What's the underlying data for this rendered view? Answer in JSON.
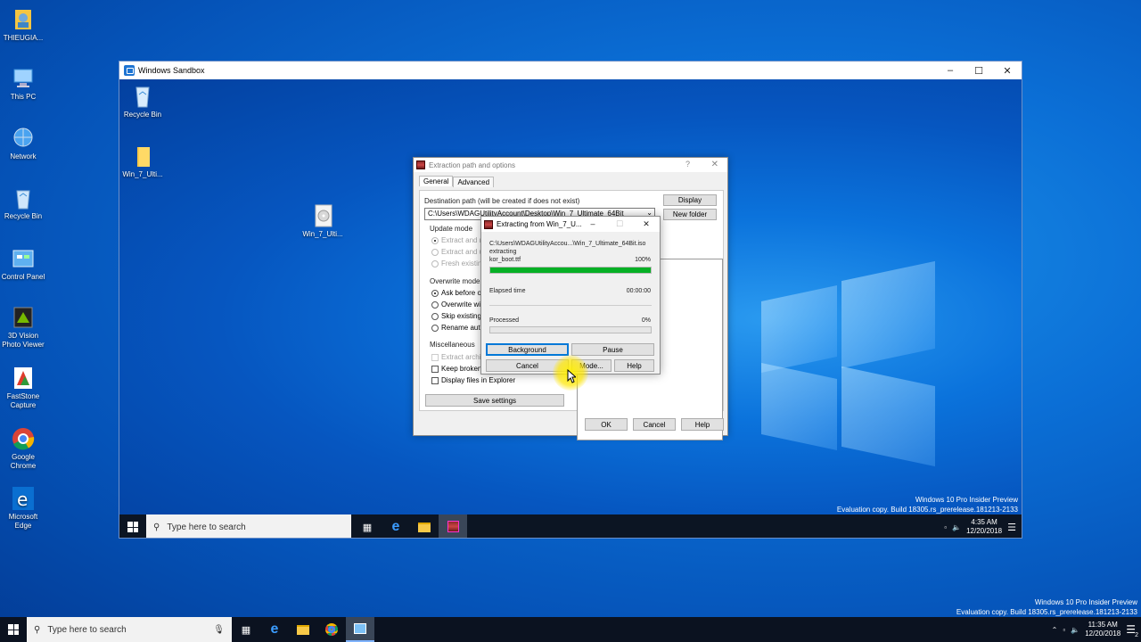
{
  "host_desktop_icons": [
    {
      "label": "THIEUGIA...",
      "icon": "user-folder-icon"
    },
    {
      "label": "This PC",
      "icon": "computer-icon"
    },
    {
      "label": "Network",
      "icon": "network-icon"
    },
    {
      "label": "Recycle Bin",
      "icon": "recycle-bin-icon"
    },
    {
      "label": "Control Panel",
      "icon": "control-panel-icon"
    },
    {
      "label": "3D Vision Photo Viewer",
      "icon": "3d-vision-icon"
    },
    {
      "label": "FastStone Capture",
      "icon": "faststone-icon"
    },
    {
      "label": "Google Chrome",
      "icon": "chrome-icon"
    },
    {
      "label": "Microsoft Edge",
      "icon": "edge-icon"
    }
  ],
  "sandbox": {
    "title": "Windows Sandbox",
    "desktop_icons": [
      {
        "label": "Recycle Bin"
      },
      {
        "label": "Win_7_Ulti..."
      },
      {
        "label": "Win_7_Ulti..."
      }
    ],
    "taskbar": {
      "search_placeholder": "Type here to search",
      "time": "4:35 AM",
      "date": "12/20/2018"
    },
    "watermark": {
      "line1": "Windows 10 Pro Insider Preview",
      "line2": "Evaluation copy. Build 18305.rs_prerelease.181213-2133"
    }
  },
  "extract_dialog": {
    "title": "Extraction path and options",
    "help_glyph": "?",
    "tabs": [
      "General",
      "Advanced"
    ],
    "dest_label": "Destination path (will be created if does not exist)",
    "dest_value": "C:\\Users\\WDAGUtilityAccount\\Desktop\\Win_7_Ultimate_64Bit",
    "display_button": "Display",
    "new_folder_button": "New folder",
    "update_mode": {
      "title": "Update mode",
      "options": [
        "Extract and re",
        "Extract and up",
        "Fresh existing"
      ]
    },
    "overwrite_mode": {
      "title": "Overwrite mode",
      "options": [
        "Ask before ove",
        "Overwrite with",
        "Skip existing fi",
        "Rename autom"
      ]
    },
    "misc": {
      "title": "Miscellaneous",
      "options": [
        "Extract archiv",
        "Keep broken fi",
        "Display files in Explorer"
      ]
    },
    "save_settings": "Save settings",
    "ok": "OK",
    "cancel": "Cancel",
    "help": "Help"
  },
  "progress_dialog": {
    "title": "Extracting from Win_7_U...",
    "archive_path": "C:\\Users\\WDAGUtilityAccou...\\Win_7_Ultimate_64Bit.iso",
    "status": "extracting",
    "current_file": "kor_boot.ttf",
    "file_percent_label": "100%",
    "file_progress": 1.0,
    "elapsed_label": "Elapsed time",
    "elapsed_value": "00:00:00",
    "processed_label": "Processed",
    "processed_percent_label": "0%",
    "processed_progress": 0.0,
    "buttons": {
      "background": "Background",
      "pause": "Pause",
      "cancel": "Cancel",
      "mode": "Mode...",
      "help": "Help"
    }
  },
  "host_taskbar": {
    "search_placeholder": "Type here to search",
    "time": "11:35 AM",
    "date": "12/20/2018",
    "notification_count": "2",
    "watermark": {
      "line1": "Windows 10 Pro Insider Preview",
      "line2": "Evaluation copy. Build 18305.rs_prerelease.181213-2133"
    }
  },
  "colors": {
    "accent": "#0078d7",
    "progress": "#06b025",
    "taskbar": "#0b1220"
  }
}
